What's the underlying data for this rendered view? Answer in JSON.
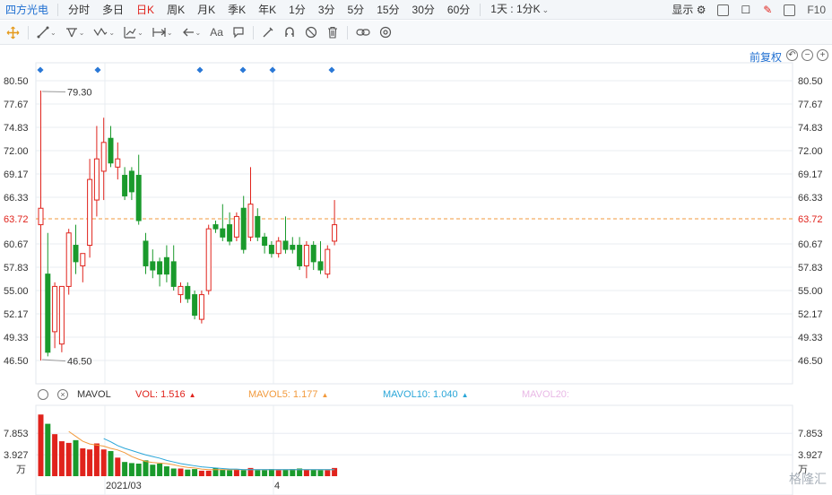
{
  "header": {
    "stock_name": "四方光电",
    "tabs": [
      {
        "label": "分时",
        "active": false
      },
      {
        "label": "多日",
        "active": false
      },
      {
        "label": "日K",
        "active": true
      },
      {
        "label": "周K",
        "active": false
      },
      {
        "label": "月K",
        "active": false
      },
      {
        "label": "季K",
        "active": false
      },
      {
        "label": "年K",
        "active": false
      },
      {
        "label": "1分",
        "active": false
      },
      {
        "label": "3分",
        "active": false
      },
      {
        "label": "5分",
        "active": false
      },
      {
        "label": "15分",
        "active": false
      },
      {
        "label": "30分",
        "active": false
      },
      {
        "label": "60分",
        "active": false
      }
    ],
    "interval_select": "1天 : 1分K",
    "display_label": "显示",
    "f10_label": "F10"
  },
  "toolbar": {
    "tools": [
      "crosshair-icon",
      "line-icon",
      "channel-icon",
      "wave-icon",
      "fib-icon",
      "range-icon",
      "arrow-icon",
      "text-icon",
      "comment-icon",
      "pen-icon",
      "magnet-icon",
      "hide-icon",
      "delete-icon",
      "link-icon",
      "settings-icon"
    ],
    "text_tool_label": "Aa"
  },
  "chart": {
    "adjust_label": "前复权",
    "y_ticks": [
      "80.50",
      "77.67",
      "74.83",
      "72.00",
      "69.17",
      "66.33",
      "63.72",
      "60.67",
      "57.83",
      "55.00",
      "52.17",
      "49.33",
      "46.50"
    ],
    "current_price": "63.72",
    "max_label": "79.30",
    "min_label": "46.50",
    "x_labels": [
      "2021/03",
      "4"
    ],
    "colors": {
      "up": "#e0231c",
      "down": "#1a9a2c",
      "price_line": "#f29a3c",
      "grid": "#e8ecf2"
    }
  },
  "chart_data": {
    "type": "candlestick",
    "ylim": [
      46.5,
      80.5
    ],
    "candles": [
      {
        "o": 63.0,
        "h": 79.3,
        "l": 46.5,
        "c": 65.0
      },
      {
        "o": 57.0,
        "h": 62.0,
        "l": 47.0,
        "c": 47.5
      },
      {
        "o": 50.0,
        "h": 56.0,
        "l": 48.0,
        "c": 55.5
      },
      {
        "o": 48.5,
        "h": 55.0,
        "l": 47.5,
        "c": 55.5
      },
      {
        "o": 55.5,
        "h": 62.5,
        "l": 54.5,
        "c": 62.0
      },
      {
        "o": 60.5,
        "h": 63.0,
        "l": 57.0,
        "c": 58.5
      },
      {
        "o": 58.0,
        "h": 59.0,
        "l": 56.0,
        "c": 59.5
      },
      {
        "o": 60.5,
        "h": 71.0,
        "l": 59.0,
        "c": 68.5
      },
      {
        "o": 66.0,
        "h": 75.0,
        "l": 64.0,
        "c": 71.0
      },
      {
        "o": 69.5,
        "h": 76.0,
        "l": 66.0,
        "c": 73.0
      },
      {
        "o": 73.5,
        "h": 75.0,
        "l": 70.0,
        "c": 70.5
      },
      {
        "o": 70.0,
        "h": 73.0,
        "l": 68.5,
        "c": 71.0
      },
      {
        "o": 69.0,
        "h": 70.0,
        "l": 66.0,
        "c": 66.5
      },
      {
        "o": 69.5,
        "h": 70.0,
        "l": 66.0,
        "c": 67.0
      },
      {
        "o": 69.0,
        "h": 71.5,
        "l": 63.0,
        "c": 63.5
      },
      {
        "o": 61.0,
        "h": 62.0,
        "l": 57.0,
        "c": 58.0
      },
      {
        "o": 58.5,
        "h": 60.0,
        "l": 56.5,
        "c": 57.5
      },
      {
        "o": 58.5,
        "h": 59.0,
        "l": 55.5,
        "c": 57.0
      },
      {
        "o": 59.0,
        "h": 60.5,
        "l": 56.0,
        "c": 57.0
      },
      {
        "o": 58.5,
        "h": 60.5,
        "l": 55.0,
        "c": 55.5
      },
      {
        "o": 54.5,
        "h": 56.0,
        "l": 53.5,
        "c": 55.5
      },
      {
        "o": 55.5,
        "h": 56.0,
        "l": 53.5,
        "c": 54.0
      },
      {
        "o": 54.5,
        "h": 55.0,
        "l": 51.5,
        "c": 52.0
      },
      {
        "o": 51.5,
        "h": 55.0,
        "l": 51.0,
        "c": 54.5
      },
      {
        "o": 55.0,
        "h": 63.0,
        "l": 54.5,
        "c": 62.5
      },
      {
        "o": 63.0,
        "h": 63.5,
        "l": 62.0,
        "c": 62.5
      },
      {
        "o": 62.5,
        "h": 65.5,
        "l": 61.0,
        "c": 61.5
      },
      {
        "o": 63.0,
        "h": 64.5,
        "l": 60.5,
        "c": 61.0
      },
      {
        "o": 61.5,
        "h": 64.5,
        "l": 61.0,
        "c": 64.0
      },
      {
        "o": 65.0,
        "h": 66.5,
        "l": 59.5,
        "c": 60.0
      },
      {
        "o": 61.5,
        "h": 70.0,
        "l": 61.0,
        "c": 65.5
      },
      {
        "o": 64.0,
        "h": 65.0,
        "l": 61.0,
        "c": 61.5
      },
      {
        "o": 61.5,
        "h": 62.0,
        "l": 59.5,
        "c": 60.5
      },
      {
        "o": 60.5,
        "h": 61.0,
        "l": 59.0,
        "c": 59.5
      },
      {
        "o": 59.5,
        "h": 61.5,
        "l": 59.0,
        "c": 61.0
      },
      {
        "o": 61.0,
        "h": 64.0,
        "l": 59.5,
        "c": 60.0
      },
      {
        "o": 60.5,
        "h": 61.5,
        "l": 59.5,
        "c": 60.0
      },
      {
        "o": 60.5,
        "h": 61.5,
        "l": 57.5,
        "c": 58.0
      },
      {
        "o": 58.0,
        "h": 61.0,
        "l": 56.5,
        "c": 60.5
      },
      {
        "o": 60.5,
        "h": 61.0,
        "l": 57.5,
        "c": 58.5
      },
      {
        "o": 58.5,
        "h": 61.0,
        "l": 57.0,
        "c": 57.5
      },
      {
        "o": 57.0,
        "h": 60.5,
        "l": 56.5,
        "c": 60.0
      },
      {
        "o": 61.0,
        "h": 66.0,
        "l": 60.5,
        "c": 63.0
      }
    ],
    "volume": {
      "y_ticks": [
        "7.853",
        "3.927"
      ],
      "unit": "万",
      "values": [
        11.3,
        9.6,
        7.7,
        6.4,
        6.1,
        6.6,
        5.1,
        4.9,
        6.0,
        4.9,
        4.6,
        3.4,
        2.6,
        2.4,
        2.3,
        2.9,
        2.1,
        2.3,
        1.8,
        1.4,
        1.4,
        1.2,
        1.3,
        1.0,
        1.0,
        1.5,
        1.2,
        1.1,
        1.2,
        1.1,
        1.5,
        1.1,
        1.1,
        1.3,
        1.1,
        1.2,
        1.3,
        1.4,
        1.2,
        1.2,
        1.1,
        1.1,
        1.5
      ],
      "ma5": [
        null,
        null,
        null,
        null,
        8.2,
        7.3,
        6.4,
        5.9,
        5.7,
        5.5,
        5.1,
        4.8,
        4.3,
        3.6,
        3.1,
        2.7,
        2.5,
        2.4,
        2.3,
        2.1,
        1.8,
        1.6,
        1.5,
        1.3,
        1.2,
        1.2,
        1.2,
        1.2,
        1.2,
        1.2,
        1.2,
        1.2,
        1.2,
        1.2,
        1.2,
        1.2,
        1.2,
        1.2,
        1.2,
        1.2,
        1.2,
        1.2,
        1.2
      ],
      "ma10": [
        null,
        null,
        null,
        null,
        null,
        null,
        null,
        null,
        null,
        6.9,
        6.3,
        5.6,
        5.1,
        4.7,
        4.3,
        3.9,
        3.6,
        3.3,
        2.9,
        2.6,
        2.3,
        2.1,
        1.9,
        1.7,
        1.6,
        1.5,
        1.4,
        1.3,
        1.3,
        1.2,
        1.2,
        1.2,
        1.2,
        1.2,
        1.2,
        1.2,
        1.2,
        1.2,
        1.2,
        1.2,
        1.2,
        1.2,
        1.2
      ]
    }
  },
  "volume_indicator": {
    "name": "MAVOL",
    "vol": "VOL: 1.516",
    "mavol5": "MAVOL5: 1.177",
    "mavol10": "MAVOL10: 1.040",
    "mavol20": "MAVOL20:",
    "colors": {
      "vol": "#e0231c",
      "mavol5": "#f29a3c",
      "mavol10": "#2aa6d8",
      "mavol20": "#e9b8e6"
    }
  },
  "watermark": "格隆汇"
}
